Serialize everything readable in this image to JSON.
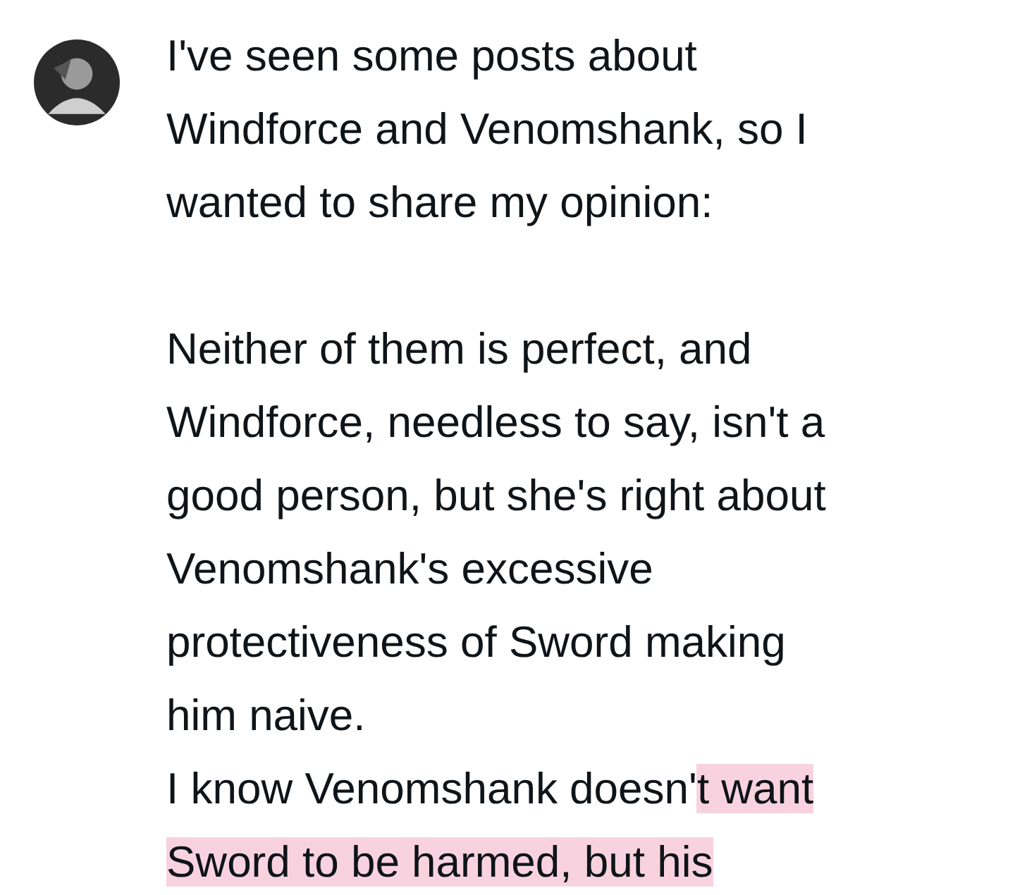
{
  "post": {
    "paragraphs": [
      {
        "lines": [
          [
            {
              "text": "I've seen some posts about",
              "highlighted": false
            }
          ],
          [
            {
              "text": "Windforce and Venomshank, so I",
              "highlighted": false
            }
          ],
          [
            {
              "text": "wanted to share my opinion:",
              "highlighted": false
            }
          ]
        ]
      },
      {
        "lines": [
          [
            {
              "text": "Neither of them is perfect, and",
              "highlighted": false
            }
          ],
          [
            {
              "text": "Windforce, needless to say, isn't a",
              "highlighted": false
            }
          ],
          [
            {
              "text": "good person, but she's right about",
              "highlighted": false
            }
          ],
          [
            {
              "text": "Venomshank's excessive",
              "highlighted": false
            }
          ],
          [
            {
              "text": "protectiveness of Sword making",
              "highlighted": false
            }
          ],
          [
            {
              "text": "him naive.",
              "highlighted": false
            }
          ],
          [
            {
              "text": "I know Venomshank doesn'",
              "highlighted": false
            },
            {
              "text": "t want",
              "highlighted": true
            }
          ],
          [
            {
              "text": "Sword to be harmed, but his",
              "highlighted": true
            }
          ]
        ]
      }
    ]
  }
}
